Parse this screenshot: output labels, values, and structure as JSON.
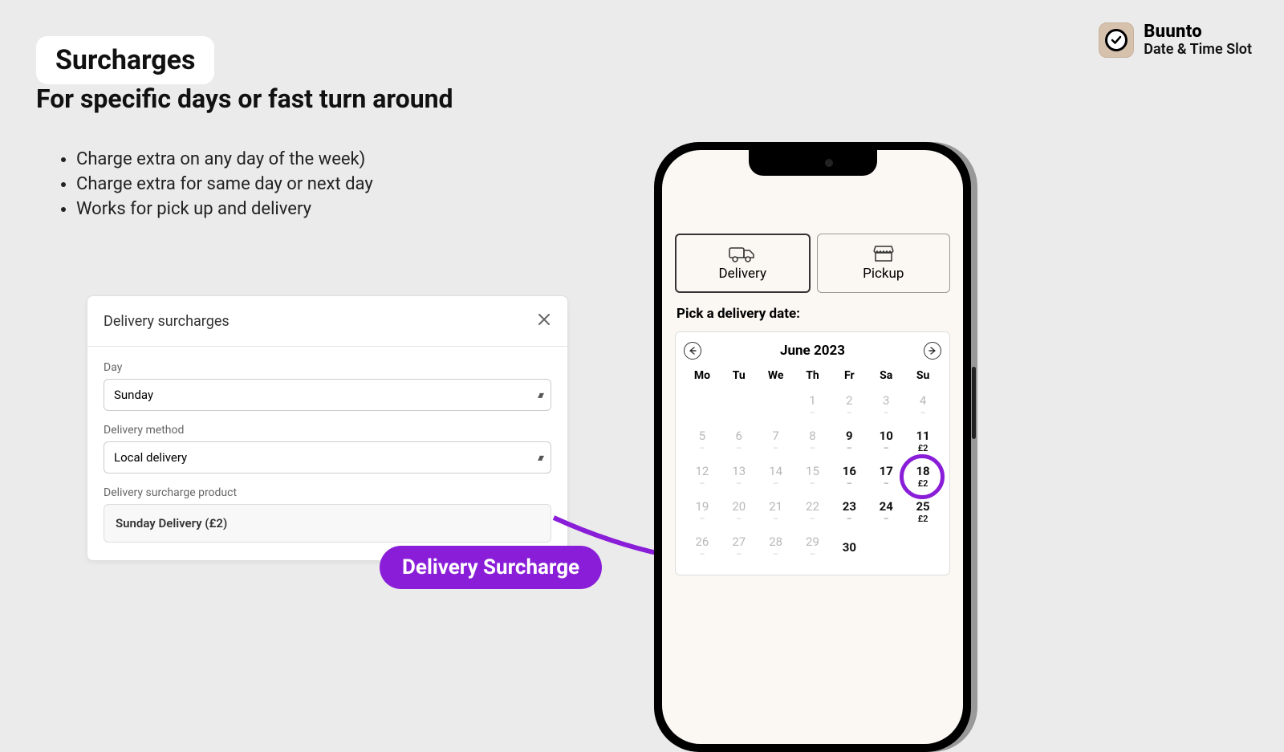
{
  "header": {
    "title_chip": "Surcharges",
    "subtitle": "For specific days or fast turn around",
    "bullets": [
      "Charge extra on any day of the week)",
      "Charge extra for same day or next day",
      "Works for pick up and delivery"
    ]
  },
  "brand": {
    "name": "Buunto",
    "tagline": "Date & Time Slot"
  },
  "modal": {
    "title": "Delivery surcharges",
    "fields": {
      "day_label": "Day",
      "day_value": "Sunday",
      "method_label": "Delivery method",
      "method_value": "Local delivery",
      "product_label": "Delivery surcharge product",
      "product_value": "Sunday Delivery (£2)"
    }
  },
  "callout": "Delivery Surcharge",
  "phone": {
    "tabs": {
      "delivery": "Delivery",
      "pickup": "Pickup"
    },
    "pick_label": "Pick a delivery date:",
    "month": "June 2023",
    "dow": [
      "Mo",
      "Tu",
      "We",
      "Th",
      "Fr",
      "Sa",
      "Su"
    ],
    "days": [
      {
        "n": "",
        "s": "",
        "cls": "empty"
      },
      {
        "n": "",
        "s": "",
        "cls": "empty"
      },
      {
        "n": "",
        "s": "",
        "cls": "empty"
      },
      {
        "n": "1",
        "s": "–",
        "cls": "disabled"
      },
      {
        "n": "2",
        "s": "–",
        "cls": "disabled"
      },
      {
        "n": "3",
        "s": "–",
        "cls": "disabled"
      },
      {
        "n": "4",
        "s": "–",
        "cls": "disabled"
      },
      {
        "n": "5",
        "s": "–",
        "cls": "disabled"
      },
      {
        "n": "6",
        "s": "–",
        "cls": "disabled"
      },
      {
        "n": "7",
        "s": "–",
        "cls": "disabled"
      },
      {
        "n": "8",
        "s": "–",
        "cls": "disabled"
      },
      {
        "n": "9",
        "s": "–",
        "cls": "available"
      },
      {
        "n": "10",
        "s": "–",
        "cls": "available"
      },
      {
        "n": "11",
        "s": "£2",
        "cls": "available surcharge"
      },
      {
        "n": "12",
        "s": "–",
        "cls": "disabled"
      },
      {
        "n": "13",
        "s": "–",
        "cls": "disabled"
      },
      {
        "n": "14",
        "s": "–",
        "cls": "disabled"
      },
      {
        "n": "15",
        "s": "–",
        "cls": "disabled"
      },
      {
        "n": "16",
        "s": "–",
        "cls": "available"
      },
      {
        "n": "17",
        "s": "–",
        "cls": "available"
      },
      {
        "n": "18",
        "s": "£2",
        "cls": "available surcharge",
        "highlight": true
      },
      {
        "n": "19",
        "s": "–",
        "cls": "disabled"
      },
      {
        "n": "20",
        "s": "–",
        "cls": "disabled"
      },
      {
        "n": "21",
        "s": "–",
        "cls": "disabled"
      },
      {
        "n": "22",
        "s": "–",
        "cls": "disabled"
      },
      {
        "n": "23",
        "s": "–",
        "cls": "available"
      },
      {
        "n": "24",
        "s": "–",
        "cls": "available"
      },
      {
        "n": "25",
        "s": "£2",
        "cls": "available surcharge"
      },
      {
        "n": "26",
        "s": "–",
        "cls": "disabled"
      },
      {
        "n": "27",
        "s": "–",
        "cls": "disabled"
      },
      {
        "n": "28",
        "s": "–",
        "cls": "disabled"
      },
      {
        "n": "29",
        "s": "–",
        "cls": "disabled"
      },
      {
        "n": "30",
        "s": "",
        "cls": "available"
      },
      {
        "n": "",
        "s": "",
        "cls": "empty"
      },
      {
        "n": "",
        "s": "",
        "cls": "empty"
      }
    ]
  }
}
